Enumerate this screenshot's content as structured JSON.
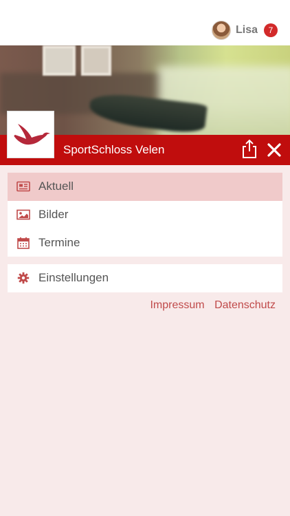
{
  "user": {
    "name": "Lisa",
    "notification_count": "7"
  },
  "header": {
    "club_name": "SportSchloss Velen"
  },
  "menu": {
    "items": [
      {
        "label": "Aktuell",
        "icon": "newspaper-icon",
        "active": true
      },
      {
        "label": "Bilder",
        "icon": "image-icon",
        "active": false
      },
      {
        "label": "Termine",
        "icon": "calendar-icon",
        "active": false
      }
    ],
    "settings": {
      "label": "Einstellungen",
      "icon": "gear-icon"
    }
  },
  "footer_links": {
    "impressum": "Impressum",
    "datenschutz": "Datenschutz"
  },
  "colors": {
    "brand_red": "#c00d0d",
    "background": "#f8eaea",
    "active_row": "#f0caca",
    "icon_red": "#c04a4a"
  }
}
